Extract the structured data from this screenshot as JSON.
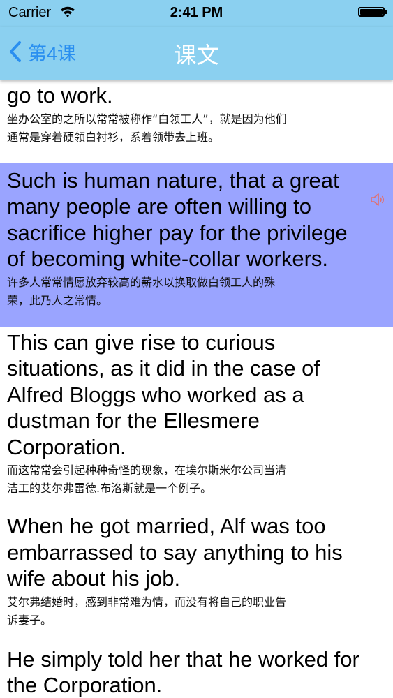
{
  "status_bar": {
    "carrier": "Carrier",
    "time": "2:41 PM"
  },
  "nav": {
    "back_label": "第4课",
    "title": "课文"
  },
  "items": [
    {
      "en": [
        "go to work."
      ],
      "zh": [
        "坐办公室的之所以常常被称作“白领工人”，就是因为他们",
        "通常是穿着硬领白衬衫，系着领带去上班。"
      ]
    },
    {
      "en": [
        "Such is human nature, that a great",
        "many people are often willing to",
        "sacrifice higher pay for the privilege",
        "of becoming white-collar workers."
      ],
      "zh": [
        "许多人常常情愿放弃较高的薪水以换取做白领工人的殊",
        "荣，此乃人之常情。"
      ]
    },
    {
      "en": [
        "This can give rise to curious",
        "situations, as it did in the case of",
        "Alfred Bloggs who worked as a",
        "dustman for the Ellesmere",
        "Corporation."
      ],
      "zh": [
        "而这常常会引起种种奇怪的现象，在埃尔斯米尔公司当清",
        "洁工的艾尔弗雷德.布洛斯就是一个例子。"
      ]
    },
    {
      "en": [
        "When he got married, Alf was too",
        "embarrassed to say anything to his",
        "wife about his job."
      ],
      "zh": [
        "艾尔弗结婚时，感到非常难为情，而没有将自己的职业告",
        "诉妻子。"
      ]
    },
    {
      "en": [
        "He simply told her that he worked for",
        "the Corporation."
      ],
      "zh": []
    }
  ],
  "icons": {
    "back": "chevron-left-icon",
    "speaker": "speaker-icon",
    "wifi": "wifi-icon",
    "battery": "battery-icon"
  },
  "colors": {
    "nav_bg": "#8bd0f0",
    "selected_row": "#9aa4ff",
    "back_tint": "#2a8ff0",
    "speaker_tint": "#e07070"
  }
}
